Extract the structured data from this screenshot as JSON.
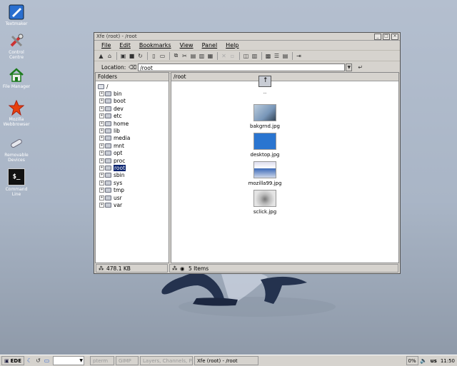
{
  "desktop": {
    "icons": [
      {
        "label": "Textmaker"
      },
      {
        "label": "Control Centre"
      },
      {
        "label": "File Manager"
      },
      {
        "label": "Mozilla Webbrowser"
      },
      {
        "label": "Removable Devices"
      },
      {
        "label": "Command Line"
      }
    ],
    "terminal_glyph": "$_"
  },
  "window": {
    "title": "Xfe (root) - /root",
    "controls": [
      "_",
      "□",
      "×"
    ],
    "menu": [
      "File",
      "Edit",
      "Bookmarks",
      "View",
      "Panel",
      "Help"
    ],
    "location_label": "Location:",
    "location_value": "/root"
  },
  "folders_pane": {
    "header": "Folders",
    "root": "/",
    "items": [
      "bin",
      "boot",
      "dev",
      "etc",
      "home",
      "lib",
      "media",
      "mnt",
      "opt",
      "proc",
      "root",
      "sbin",
      "sys",
      "tmp",
      "usr",
      "var"
    ],
    "selected": "root",
    "status": "478.1 KB"
  },
  "files_pane": {
    "header": "/root",
    "files": [
      {
        "name": "..",
        "kind": "updir"
      },
      {
        "name": "bakgrnd.jpg",
        "kind": "image"
      },
      {
        "name": "desktop.jpg",
        "kind": "image"
      },
      {
        "name": "mozilla99.jpg",
        "kind": "image"
      },
      {
        "name": "sclick.jpg",
        "kind": "image"
      }
    ],
    "status": "5 Items"
  },
  "taskbar": {
    "start": "EDE",
    "tasks": [
      {
        "label": "pterm",
        "dim": true
      },
      {
        "label": "GIMP",
        "dim": true
      },
      {
        "label": "Layers, Channels, Pa",
        "dim": true
      },
      {
        "label": "Xfe (root) - /root",
        "dim": false
      }
    ],
    "cpu": "0%",
    "layout": "us",
    "clock": "11:50"
  },
  "colors": {
    "selection": "#0a2470",
    "desktop_bg": "#a9b5c6"
  }
}
